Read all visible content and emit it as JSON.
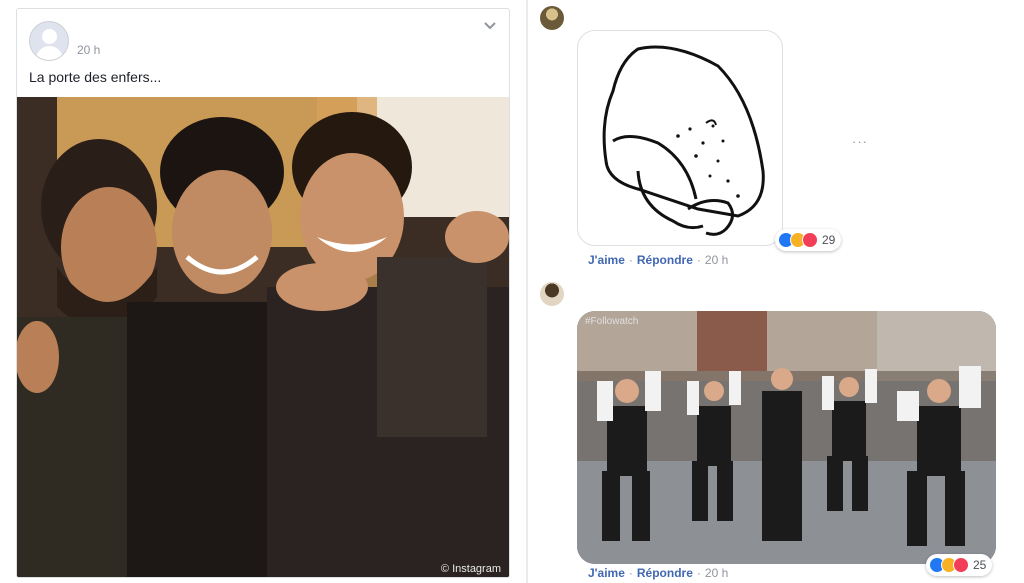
{
  "post": {
    "time": "20 h",
    "text": "La porte des enfers...",
    "photo_credit": "© Instagram",
    "options_icon": "chevron-down-icon"
  },
  "comments": [
    {
      "attachment": "sticker",
      "reactions": {
        "icons": [
          "like",
          "haha",
          "love"
        ],
        "count": "29"
      },
      "actions": {
        "like": "J'aime",
        "reply": "Répondre",
        "time": "20 h"
      },
      "more": "···"
    },
    {
      "attachment": "gif",
      "gif_tag": "#Followatch",
      "reactions": {
        "icons": [
          "like",
          "haha",
          "love"
        ],
        "count": "25"
      },
      "actions": {
        "like": "J'aime",
        "reply": "Répondre",
        "time": "20 h"
      }
    }
  ],
  "colors": {
    "link": "#4267b2",
    "meta": "#90949c",
    "like": "#2078f4",
    "haha": "#f7b125",
    "love": "#f33e58"
  }
}
